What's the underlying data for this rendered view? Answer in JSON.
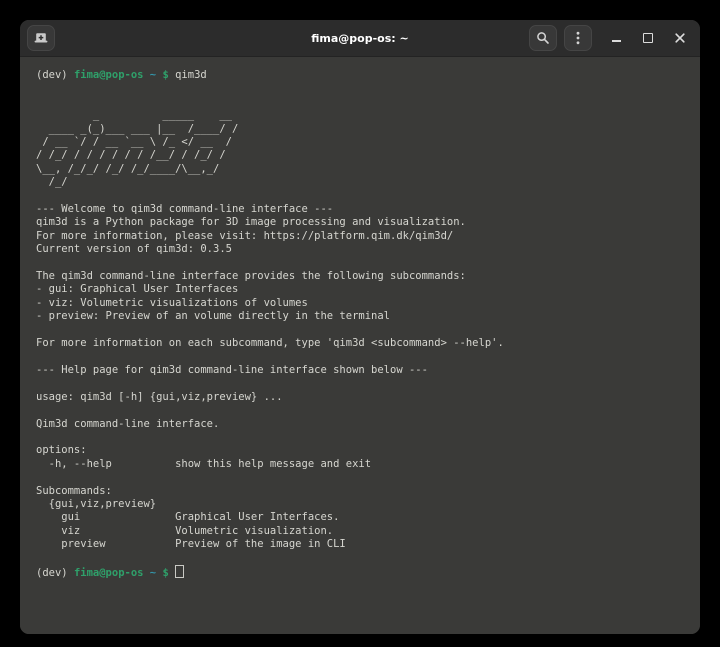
{
  "window": {
    "title": "fima@pop-os: ~"
  },
  "titlebar": {
    "icons": {
      "new_tab": "tab-new-icon",
      "search": "search-icon",
      "menu": "kebab-menu-icon",
      "minimize": "minimize-icon",
      "maximize": "maximize-icon",
      "close": "close-icon"
    }
  },
  "terminal": {
    "prompt": {
      "venv": "(dev) ",
      "user_host": "fima@pop-os",
      "cwd": " ~ ",
      "dollar": "$ "
    },
    "command": "qim3d",
    "version": "0.3.5",
    "output_lines": [
      "",
      "",
      "         _          _____    __",
      "  ____ _(_)___ ___ |__  /____/ /",
      " / __ `/ / __ `__ \\ /_ </ __  /",
      "/ /_/ / / / / / / /__/ / /_/ /",
      "\\__, /_/_/ /_/ /_/____/\\__,_/",
      "  /_/",
      "",
      "--- Welcome to qim3d command-line interface ---",
      "qim3d is a Python package for 3D image processing and visualization.",
      "For more information, please visit: https://platform.qim.dk/qim3d/",
      "Current version of qim3d: 0.3.5",
      "",
      "The qim3d command-line interface provides the following subcommands:",
      "- gui: Graphical User Interfaces",
      "- viz: Volumetric visualizations of volumes",
      "- preview: Preview of an volume directly in the terminal",
      "",
      "For more information on each subcommand, type 'qim3d <subcommand> --help'.",
      "",
      "--- Help page for qim3d command-line interface shown below ---",
      "",
      "usage: qim3d [-h] {gui,viz,preview} ...",
      "",
      "Qim3d command-line interface.",
      "",
      "options:",
      "  -h, --help          show this help message and exit",
      "",
      "Subcommands:",
      "  {gui,viz,preview}",
      "    gui               Graphical User Interfaces.",
      "    viz               Volumetric visualization.",
      "    preview           Preview of the image in CLI",
      "",
      ""
    ]
  },
  "colors": {
    "surround": "#000000",
    "headerbar_bg": "#2c2c2c",
    "terminal_bg": "#3a3a38",
    "foreground": "#d6d6d0",
    "prompt_green": "#2fa06a",
    "prompt_teal": "#3494a8",
    "title_fg": "#ffffff"
  }
}
